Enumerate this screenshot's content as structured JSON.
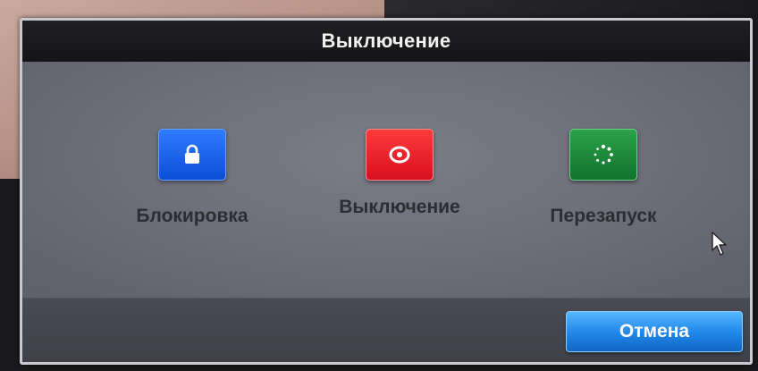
{
  "dialog": {
    "title": "Выключение",
    "options": [
      {
        "label": "Блокировка",
        "icon": "lock-icon",
        "color": "#1e66f0"
      },
      {
        "label": "Выключение",
        "icon": "power-icon",
        "color": "#e3202c"
      },
      {
        "label": "Перезапуск",
        "icon": "restart-icon",
        "color": "#1d8a3a"
      }
    ],
    "cancel_label": "Отмена"
  },
  "colors": {
    "title_bar": "#1a1a1c",
    "panel": "#6f6f7a",
    "footer": "#45454f",
    "accent": "#1f86e8"
  }
}
